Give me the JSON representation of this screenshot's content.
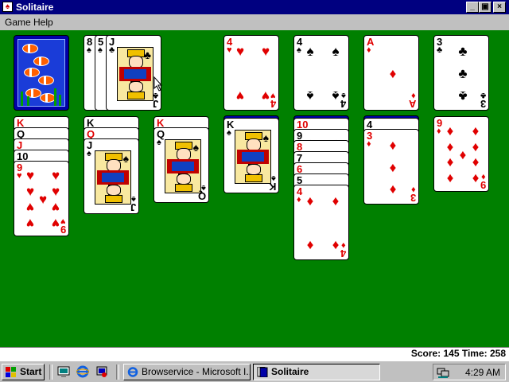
{
  "window": {
    "title": "Solitaire",
    "title_icon": "solitaire-card-icon"
  },
  "window_controls": {
    "minimize": "_",
    "maximize": "▣",
    "close": "×"
  },
  "menu": {
    "items": [
      "Game",
      "Help"
    ]
  },
  "status": {
    "score_text": "Score: 145  Time: 258"
  },
  "stock": {
    "back_design": "fish"
  },
  "waste": [
    {
      "rank": "8",
      "suit": "♠",
      "color": "black"
    },
    {
      "rank": "5",
      "suit": "♠",
      "color": "black"
    },
    {
      "rank": "J",
      "suit": "♣",
      "color": "black"
    }
  ],
  "foundations": [
    {
      "rank": "4",
      "suit": "♥",
      "color": "red"
    },
    {
      "rank": "4",
      "suit": "♠",
      "color": "black"
    },
    {
      "rank": "A",
      "suit": "♦",
      "color": "red"
    },
    {
      "rank": "3",
      "suit": "♣",
      "color": "black"
    }
  ],
  "tableau": [
    {
      "cards": [
        {
          "rank": "K",
          "suit": "♥",
          "color": "red"
        },
        {
          "rank": "Q",
          "suit": "♣",
          "color": "black"
        },
        {
          "rank": "J",
          "suit": "♦",
          "color": "red"
        },
        {
          "rank": "10",
          "suit": "♠",
          "color": "black"
        },
        {
          "rank": "9",
          "suit": "♥",
          "color": "red"
        }
      ]
    },
    {
      "cards": [
        {
          "rank": "K",
          "suit": "♠",
          "color": "black"
        },
        {
          "rank": "Q",
          "suit": "♦",
          "color": "red"
        },
        {
          "rank": "J",
          "suit": "♠",
          "color": "black"
        }
      ]
    },
    {
      "cards": [
        {
          "rank": "K",
          "suit": "♦",
          "color": "red"
        },
        {
          "rank": "Q",
          "suit": "♠",
          "color": "black"
        }
      ]
    },
    {
      "cards": [
        {
          "rank": "K",
          "suit": "♠",
          "color": "black"
        }
      ]
    },
    {
      "cards": [
        {
          "rank": "10",
          "suit": "♥",
          "color": "red"
        },
        {
          "rank": "9",
          "suit": "♠",
          "color": "black"
        },
        {
          "rank": "8",
          "suit": "♥",
          "color": "red"
        },
        {
          "rank": "7",
          "suit": "♠",
          "color": "black"
        },
        {
          "rank": "6",
          "suit": "♥",
          "color": "red"
        },
        {
          "rank": "5",
          "suit": "♠",
          "color": "black"
        },
        {
          "rank": "4",
          "suit": "♦",
          "color": "red"
        }
      ]
    },
    {
      "cards": [
        {
          "rank": "4",
          "suit": "♠",
          "color": "black"
        },
        {
          "rank": "3",
          "suit": "♦",
          "color": "red"
        }
      ]
    },
    {
      "cards": [
        {
          "rank": "9",
          "suit": "♦",
          "color": "red"
        }
      ]
    }
  ],
  "taskbar": {
    "start_label": "Start",
    "quick_launch": [
      "desktop-icon",
      "internet-explorer-icon",
      "channels-icon"
    ],
    "buttons": [
      {
        "label": "Browservice - Microsoft I...",
        "icon": "internet-explorer-icon",
        "active": false
      },
      {
        "label": "Solitaire",
        "icon": "solitaire-card-icon",
        "active": true
      }
    ],
    "clock": "4:29 AM"
  },
  "colors": {
    "table_green": "#008000",
    "title_blue": "#000080",
    "red_suit": "#e00000",
    "card_back": "#0000a8"
  }
}
